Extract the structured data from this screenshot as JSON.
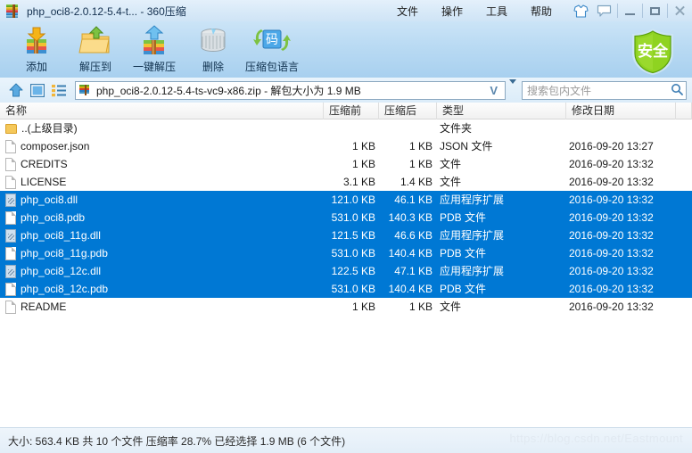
{
  "window": {
    "title": "php_oci8-2.0.12-5.4-t... - 360压缩",
    "app_icon": "archive-icon",
    "menu": [
      {
        "label": "文件",
        "name": "menu-file"
      },
      {
        "label": "操作",
        "name": "menu-operation"
      },
      {
        "label": "工具",
        "name": "menu-tools"
      },
      {
        "label": "帮助",
        "name": "menu-help"
      }
    ],
    "icon_buttons": [
      {
        "name": "skin-icon",
        "title": "换肤"
      },
      {
        "name": "feedback-icon",
        "title": "反馈"
      }
    ],
    "controls": [
      {
        "name": "minimize-button"
      },
      {
        "name": "maximize-button"
      },
      {
        "name": "close-button"
      }
    ]
  },
  "toolbar": {
    "buttons": [
      {
        "label": "添加",
        "icon": "add-archive-icon",
        "name": "toolbar-add"
      },
      {
        "label": "解压到",
        "icon": "extract-to-icon",
        "name": "toolbar-extract-to"
      },
      {
        "label": "一键解压",
        "icon": "one-click-extract-icon",
        "name": "toolbar-one-click-extract"
      },
      {
        "label": "删除",
        "icon": "delete-trash-icon",
        "name": "toolbar-delete"
      },
      {
        "label": "压缩包语言",
        "icon": "archive-language-icon",
        "name": "toolbar-archive-language"
      }
    ],
    "shield": {
      "label": "安全",
      "icon": "safe-shield-icon",
      "color": "#7ac21c"
    }
  },
  "navbar": {
    "up_button": "up-arrow-icon",
    "panel_button": "preview-pane-icon",
    "list_button": "list-view-icon",
    "address_value": "php_oci8-2.0.12-5.4-ts-vc9-x86.zip - 解包大小为 1.9 MB",
    "address_v_glyph": "V",
    "dropdown": "chevron-down-icon",
    "search_placeholder": "搜索包内文件",
    "search_icon": "search-icon"
  },
  "columns": [
    {
      "label": "名称",
      "key": "name"
    },
    {
      "label": "压缩前",
      "key": "pre"
    },
    {
      "label": "压缩后",
      "key": "post"
    },
    {
      "label": "类型",
      "key": "type"
    },
    {
      "label": "修改日期",
      "key": "date"
    }
  ],
  "rows": [
    {
      "name": "..(上级目录)",
      "pre": "",
      "post": "",
      "type": "文件夹",
      "date": "",
      "icon": "folder-icon",
      "selected": false
    },
    {
      "name": "composer.json",
      "pre": "1 KB",
      "post": "1 KB",
      "type": "JSON 文件",
      "date": "2016-09-20 13:27",
      "icon": "file-icon",
      "selected": false
    },
    {
      "name": "CREDITS",
      "pre": "1 KB",
      "post": "1 KB",
      "type": "文件",
      "date": "2016-09-20 13:32",
      "icon": "file-icon",
      "selected": false
    },
    {
      "name": "LICENSE",
      "pre": "3.1 KB",
      "post": "1.4 KB",
      "type": "文件",
      "date": "2016-09-20 13:32",
      "icon": "file-icon",
      "selected": false
    },
    {
      "name": "php_oci8.dll",
      "pre": "121.0 KB",
      "post": "46.1 KB",
      "type": "应用程序扩展",
      "date": "2016-09-20 13:32",
      "icon": "dll-icon",
      "selected": true
    },
    {
      "name": "php_oci8.pdb",
      "pre": "531.0 KB",
      "post": "140.3 KB",
      "type": "PDB 文件",
      "date": "2016-09-20 13:32",
      "icon": "file-icon",
      "selected": true
    },
    {
      "name": "php_oci8_11g.dll",
      "pre": "121.5 KB",
      "post": "46.6 KB",
      "type": "应用程序扩展",
      "date": "2016-09-20 13:32",
      "icon": "dll-icon",
      "selected": true
    },
    {
      "name": "php_oci8_11g.pdb",
      "pre": "531.0 KB",
      "post": "140.4 KB",
      "type": "PDB 文件",
      "date": "2016-09-20 13:32",
      "icon": "file-icon",
      "selected": true
    },
    {
      "name": "php_oci8_12c.dll",
      "pre": "122.5 KB",
      "post": "47.1 KB",
      "type": "应用程序扩展",
      "date": "2016-09-20 13:32",
      "icon": "dll-icon",
      "selected": true
    },
    {
      "name": "php_oci8_12c.pdb",
      "pre": "531.0 KB",
      "post": "140.4 KB",
      "type": "PDB 文件",
      "date": "2016-09-20 13:32",
      "icon": "file-icon",
      "selected": true
    },
    {
      "name": "README",
      "pre": "1 KB",
      "post": "1 KB",
      "type": "文件",
      "date": "2016-09-20 13:32",
      "icon": "file-icon",
      "selected": false
    }
  ],
  "statusbar": {
    "text": "大小: 563.4 KB 共 10 个文件 压缩率 28.7% 已经选择 1.9 MB (6 个文件)"
  },
  "watermark": "https://blog.csdn.net/Eastmount",
  "colors": {
    "selection": "#0078d4",
    "titlebar": "#d9eaf8",
    "toolbar": "#b9daf3",
    "shield_green": "#7ac21c"
  }
}
